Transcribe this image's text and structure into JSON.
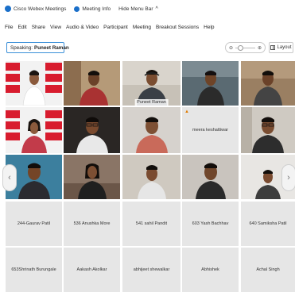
{
  "titlebar": {
    "app_name": "Cisco Webex Meetings",
    "meeting_info": "Meeting Info",
    "hide_menu": "Hide Menu Bar",
    "hide_menu_chevron": "^"
  },
  "menubar": {
    "items": [
      "File",
      "Edit",
      "Share",
      "View",
      "Audio & Video",
      "Participant",
      "Meeting",
      "Breakout Sessions",
      "Help"
    ]
  },
  "speaking": {
    "label": "Speaking:",
    "name": "Puneet Raman"
  },
  "zoom": {
    "minus": "⊖",
    "plus": "⊕"
  },
  "layout_button": {
    "label": "Layout"
  },
  "nav": {
    "left": "‹",
    "right": "›"
  },
  "tiles": {
    "active_name": "Puneet Raman",
    "mic_off_name": "meera keshattiwar",
    "mic_icon": "▲",
    "row4": [
      "244-Gaurav Patil",
      "536 Anushka More",
      "541 sahil Pandit",
      "603 Yash Bachhav",
      "640 Samiksha Patil"
    ],
    "row5": [
      "653Shrinath Burungale",
      "Aakash Akolkar",
      "abhijeet shewalkar",
      "Abhishek",
      "Achal Singh"
    ]
  },
  "colors": {
    "accent": "#3a8fd8",
    "webex_blue": "#1a6fc9"
  }
}
